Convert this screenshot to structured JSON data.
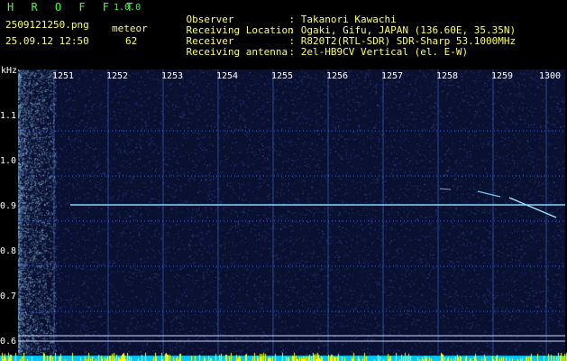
{
  "header": {
    "app_title": "H R O F F T",
    "app_version": "1.0.0",
    "file_name": "2509121250.png",
    "meteor_label": "meteor",
    "timestamp": "25.09.12 12:50",
    "meteor_count": "62"
  },
  "info": [
    {
      "label": "Observer",
      "value": ": Takanori Kawachi"
    },
    {
      "label": "Receiving Location",
      "value": ": Ogaki, Gifu, JAPAN (136.60E, 35.35N)"
    },
    {
      "label": "Receiver",
      "value": ": R820T2(RTL-SDR) SDR-Sharp 53.1000MHz"
    },
    {
      "label": "Receiving antenna",
      "value": ": 2el-HB9CV Vertical (el. E-W)"
    }
  ],
  "axes": {
    "y_unit": "kHz",
    "y_ticks": [
      "1.1",
      "1.0",
      "0.9",
      "0.8",
      "0.7",
      "0.6"
    ],
    "x_ticks": [
      "1251",
      "1252",
      "1253",
      "1254",
      "1255",
      "1256",
      "1257",
      "1258",
      "1259",
      "1300"
    ]
  },
  "colors": {
    "background": "#000000",
    "title_green": "#3fff3f",
    "text_yellow": "#ffff66",
    "spectrogram_bg": "#0a1030",
    "carrier": "#7fd8ff",
    "strip_yellow": "#ffff00",
    "strip_cyan": "#00c8ff"
  }
}
